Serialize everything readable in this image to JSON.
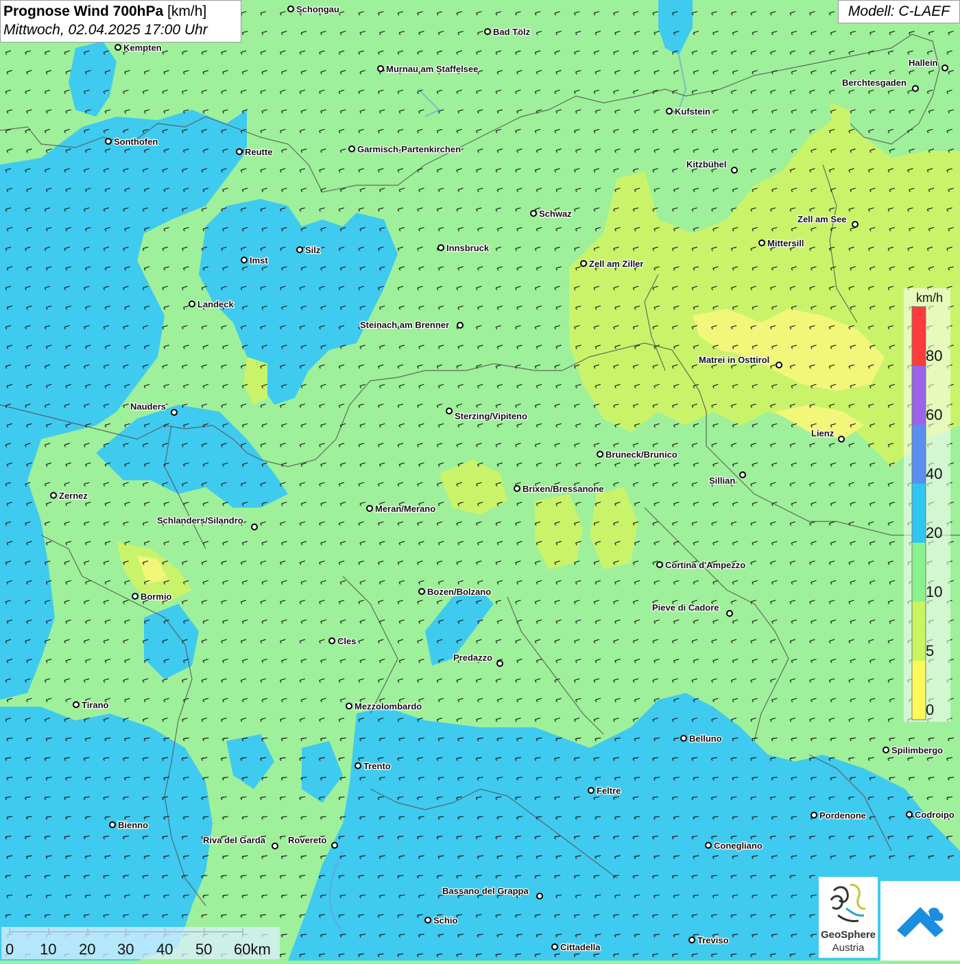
{
  "header": {
    "title": "Prognose Wind 700hPa",
    "unit": "[km/h]",
    "datetime": "Mittwoch, 02.04.2025 17:00 Uhr"
  },
  "model": "Modell: C-LAEF",
  "legend": {
    "unit": "km/h",
    "ticks": [
      "80",
      "60",
      "40",
      "20",
      "10",
      "5",
      "0"
    ],
    "colors": [
      "#ff3a3a",
      "#9a63e8",
      "#5a8ef0",
      "#2fc6f2",
      "#8bf08e",
      "#c8f560",
      "#fff85a"
    ]
  },
  "scale_bar": {
    "labels": [
      "0",
      "10",
      "20",
      "30",
      "40",
      "50",
      "60km"
    ]
  },
  "logos": {
    "geosphere_name": "GeoSphere",
    "geosphere_country": "Austria",
    "icons": [
      "geosphere-logo-icon",
      "warning-app-icon"
    ]
  },
  "colors": {
    "calm_yellow": "#fff85a",
    "light_green": "#c8f560",
    "green": "#9ef09a",
    "cyan": "#2fc6f2",
    "arrow": "#222222",
    "border_line": "#555555"
  },
  "wind": {
    "direction_description": "from east-northeast",
    "arrow_icon": "arrow-icon"
  },
  "cities": [
    {
      "name": "Schongau"
    },
    {
      "name": "Bad Tölz"
    },
    {
      "name": "Kempten"
    },
    {
      "name": "Murnau am Staffelsee"
    },
    {
      "name": "Halleín"
    },
    {
      "name": "Berchtesgaden"
    },
    {
      "name": "Kufstein"
    },
    {
      "name": "Sonthofen"
    },
    {
      "name": "Reutte"
    },
    {
      "name": "Garmisch-Partenkirchen"
    },
    {
      "name": "Kitzbühel"
    },
    {
      "name": "Schwaz"
    },
    {
      "name": "Zell am See"
    },
    {
      "name": "Mittersill"
    },
    {
      "name": "Silz"
    },
    {
      "name": "Innsbruck"
    },
    {
      "name": "Imst"
    },
    {
      "name": "Zell am Ziller"
    },
    {
      "name": "Landeck"
    },
    {
      "name": "Steinach am Brenner"
    },
    {
      "name": "Matrei in Osttirol"
    },
    {
      "name": "Nauders"
    },
    {
      "name": "Sterzing/Vipiteno"
    },
    {
      "name": "Lienz"
    },
    {
      "name": "Bruneck/Brunico"
    },
    {
      "name": "Sillian"
    },
    {
      "name": "Zernez"
    },
    {
      "name": "Brixen/Bressanone"
    },
    {
      "name": "Meran/Merano"
    },
    {
      "name": "Schlanders/Silandro"
    },
    {
      "name": "Cortina d'Ampezzo"
    },
    {
      "name": "Bozen/Bolzano"
    },
    {
      "name": "Bormio"
    },
    {
      "name": "Pieve di Cadore"
    },
    {
      "name": "Cles"
    },
    {
      "name": "Predazzo"
    },
    {
      "name": "Tirano"
    },
    {
      "name": "Mezzolombardo"
    },
    {
      "name": "Belluno"
    },
    {
      "name": "Spilimbergo"
    },
    {
      "name": "Trento"
    },
    {
      "name": "Feltre"
    },
    {
      "name": "Bienno"
    },
    {
      "name": "Pordenone"
    },
    {
      "name": "Codroipo"
    },
    {
      "name": "Riva del Garda"
    },
    {
      "name": "Rovereto"
    },
    {
      "name": "Conegliano"
    },
    {
      "name": "Bassano del Grappa"
    },
    {
      "name": "Schio"
    },
    {
      "name": "Treviso"
    },
    {
      "name": "Cittadella"
    }
  ]
}
